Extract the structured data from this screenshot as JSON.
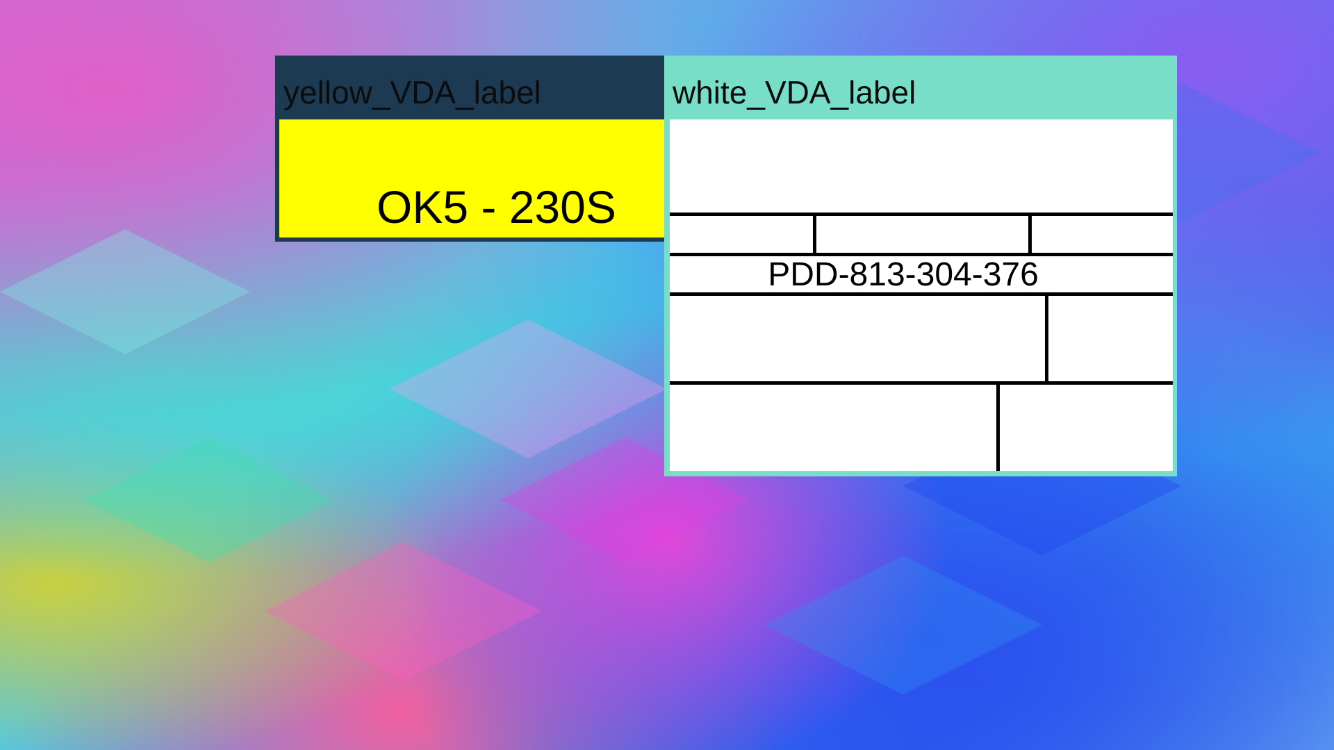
{
  "background": {
    "style": "abstract geometric cubes",
    "colors": [
      "#e060c8",
      "#4ad8d0",
      "#3a8af0",
      "#2a50f0",
      "#c8d040"
    ]
  },
  "yellow_panel": {
    "header_label": "yellow_VDA_label",
    "code": "OK5 - 230S",
    "header_color": "#1c3a52",
    "body_color": "#ffff00"
  },
  "white_panel": {
    "header_label": "white_VDA_label",
    "serial": "PDD-813-304-376",
    "header_color": "#79dec8",
    "body_color": "#ffffff"
  }
}
